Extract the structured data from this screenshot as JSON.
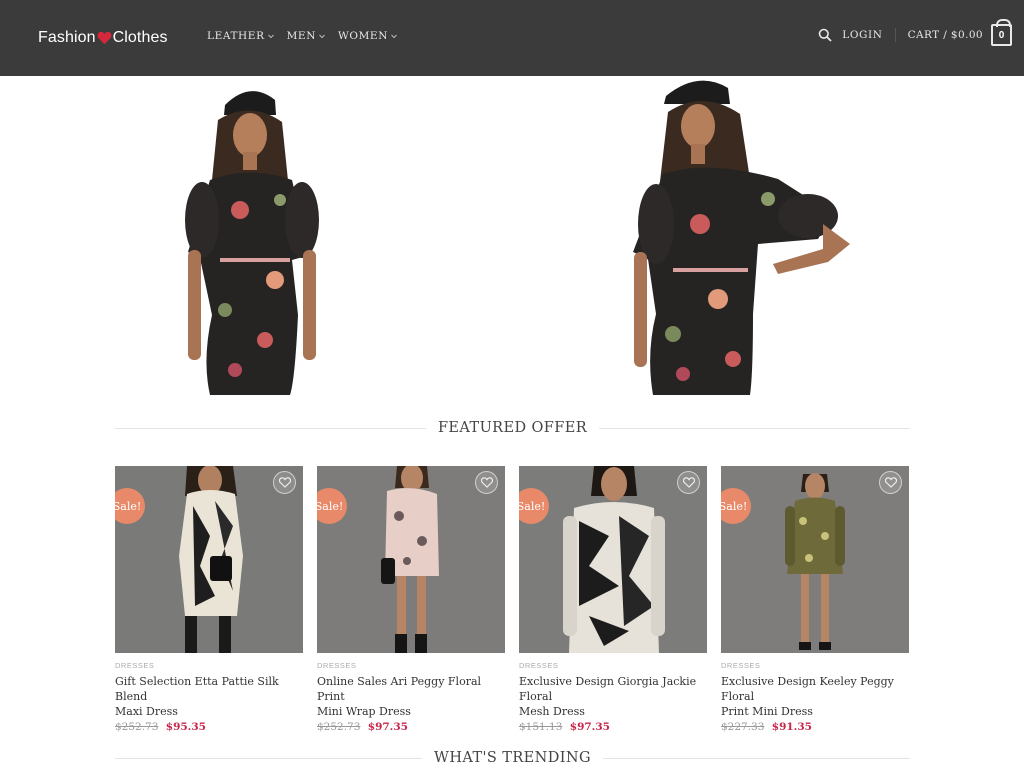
{
  "header": {
    "logo_left": "Fashion",
    "logo_right": "Clothes",
    "nav": [
      {
        "label": "LEATHER"
      },
      {
        "label": "MEN"
      },
      {
        "label": "WOMEN"
      }
    ],
    "login": "LOGIN",
    "cart": "CART / $0.00",
    "cart_count": "0"
  },
  "sections": {
    "featured": "FEATURED OFFER",
    "trending": "WHAT'S TRENDING"
  },
  "products": [
    {
      "badge": "Sale!",
      "category": "DRESSES",
      "name_l1": "Gift Selection Etta Pattie Silk Blend",
      "name_l2": "Maxi Dress",
      "old_price": "$252.73",
      "new_price": "$95.35"
    },
    {
      "badge": "Sale!",
      "category": "DRESSES",
      "name_l1": "Online Sales Ari Peggy Floral Print",
      "name_l2": "Mini Wrap Dress",
      "old_price": "$252.73",
      "new_price": "$97.35"
    },
    {
      "badge": "Sale!",
      "category": "DRESSES",
      "name_l1": "Exclusive Design Giorgia Jackie Floral",
      "name_l2": "Mesh Dress",
      "old_price": "$151.13",
      "new_price": "$97.35"
    },
    {
      "badge": "Sale!",
      "category": "DRESSES",
      "name_l1": "Exclusive Design Keeley Peggy Floral",
      "name_l2": "Print Mini Dress",
      "old_price": "$227.33",
      "new_price": "$91.35"
    }
  ],
  "colors": {
    "header_bg": "#3b3b3b",
    "sale_badge": "#e88a6a",
    "price_accent": "#c7264a"
  },
  "icons": [
    "heart-logo-icon",
    "chevron-down-icon",
    "search-icon",
    "cart-icon",
    "wishlist-heart-icon"
  ]
}
